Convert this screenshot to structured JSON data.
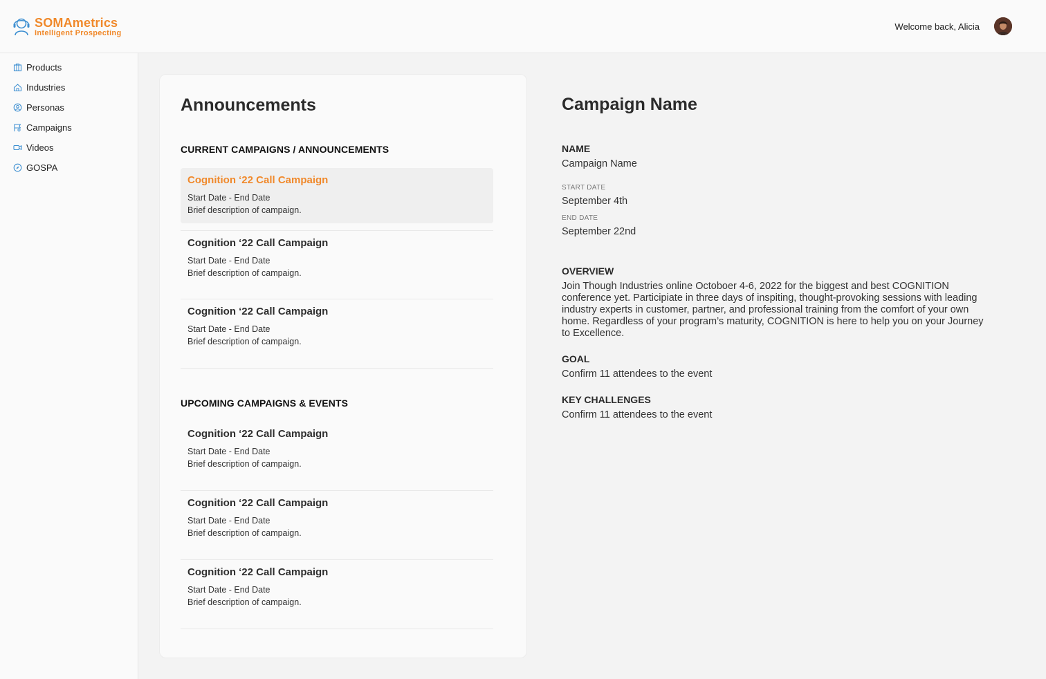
{
  "brand": {
    "name": "SOMAmetrics",
    "tagline": "Intelligent Prospecting",
    "accent": "#f0892b",
    "icon_accent": "#3d8fd1"
  },
  "header": {
    "welcome": "Welcome back, Alicia"
  },
  "sidebar": {
    "items": [
      {
        "label": "Products",
        "icon": "box-icon"
      },
      {
        "label": "Industries",
        "icon": "home-icon"
      },
      {
        "label": "Personas",
        "icon": "user-circle-icon"
      },
      {
        "label": "Campaigns",
        "icon": "flag-icon"
      },
      {
        "label": "Videos",
        "icon": "video-camera-icon"
      },
      {
        "label": "GOSPA",
        "icon": "compass-icon"
      }
    ]
  },
  "announcements": {
    "title": "Announcements",
    "current_heading": "CURRENT CAMPAIGNS / ANNOUNCEMENTS",
    "upcoming_heading": "UPCOMING CAMPAIGNS & EVENTS",
    "current": [
      {
        "name": "Cognition ‘22 Call Campaign",
        "dates": "Start Date - End Date",
        "desc": "Brief description of campaign."
      },
      {
        "name": "Cognition ‘22 Call Campaign",
        "dates": "Start Date - End Date",
        "desc": "Brief description of campaign."
      },
      {
        "name": "Cognition ‘22 Call Campaign",
        "dates": "Start Date - End Date",
        "desc": "Brief description of campaign."
      }
    ],
    "upcoming": [
      {
        "name": "Cognition ‘22 Call Campaign",
        "dates": "Start Date - End Date",
        "desc": "Brief description of campaign."
      },
      {
        "name": "Cognition ‘22 Call Campaign",
        "dates": "Start Date - End Date",
        "desc": "Brief description of campaign."
      },
      {
        "name": "Cognition ‘22 Call Campaign",
        "dates": "Start Date - End Date",
        "desc": "Brief description of campaign."
      }
    ]
  },
  "detail": {
    "title": "Campaign Name",
    "name_label": "NAME",
    "name_value": "Campaign Name",
    "start_label": "START DATE",
    "start_value": "September 4th",
    "end_label": "END DATE",
    "end_value": "September 22nd",
    "overview_label": "OVERVIEW",
    "overview_text": "Join Though Industries online Octoboer 4-6, 2022 for the biggest and best COGNITION conference yet. Participiate in three days of inspiting, thought-provoking sessions with leading industry experts in customer, partner, and professional training from the comfort of your own home. Regardless of your program’s maturity, COGNITION is here to help you on your Journey to Excellence.",
    "goal_label": "GOAL",
    "goal_text": "Confirm 11 attendees to the event",
    "challenges_label": "KEY CHALLENGES",
    "challenges_text": "Confirm 11 attendees to the event"
  }
}
